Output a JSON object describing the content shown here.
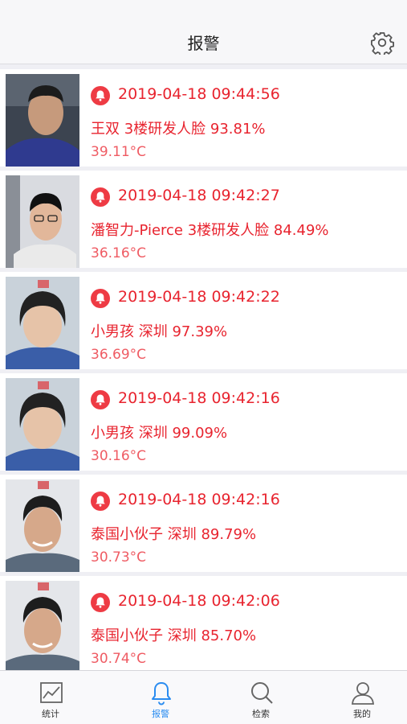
{
  "header": {
    "title": "报警"
  },
  "alarms": [
    {
      "time": "2019-04-18 09:44:56",
      "desc": "王双 3楼研发人脸 93.81%",
      "temp": "39.11°C"
    },
    {
      "time": "2019-04-18 09:42:27",
      "desc": "潘智力-Pierce 3楼研发人脸 84.49%",
      "temp": "36.16°C"
    },
    {
      "time": "2019-04-18 09:42:22",
      "desc": "小男孩 深圳 97.39%",
      "temp": "36.69°C"
    },
    {
      "time": "2019-04-18 09:42:16",
      "desc": "小男孩 深圳 99.09%",
      "temp": "30.16°C"
    },
    {
      "time": "2019-04-18 09:42:16",
      "desc": "泰国小伙子 深圳 89.79%",
      "temp": "30.73°C"
    },
    {
      "time": "2019-04-18 09:42:06",
      "desc": "泰国小伙子 深圳 85.70%",
      "temp": "30.74°C"
    }
  ],
  "tabs": [
    {
      "label": "统计",
      "icon": "chart-icon"
    },
    {
      "label": "报警",
      "icon": "bell-icon"
    },
    {
      "label": "检索",
      "icon": "search-icon"
    },
    {
      "label": "我的",
      "icon": "user-icon"
    }
  ],
  "active_tab": "报警",
  "colors": {
    "alarm_red": "#e8242f",
    "accent_blue": "#2a8cf0"
  }
}
